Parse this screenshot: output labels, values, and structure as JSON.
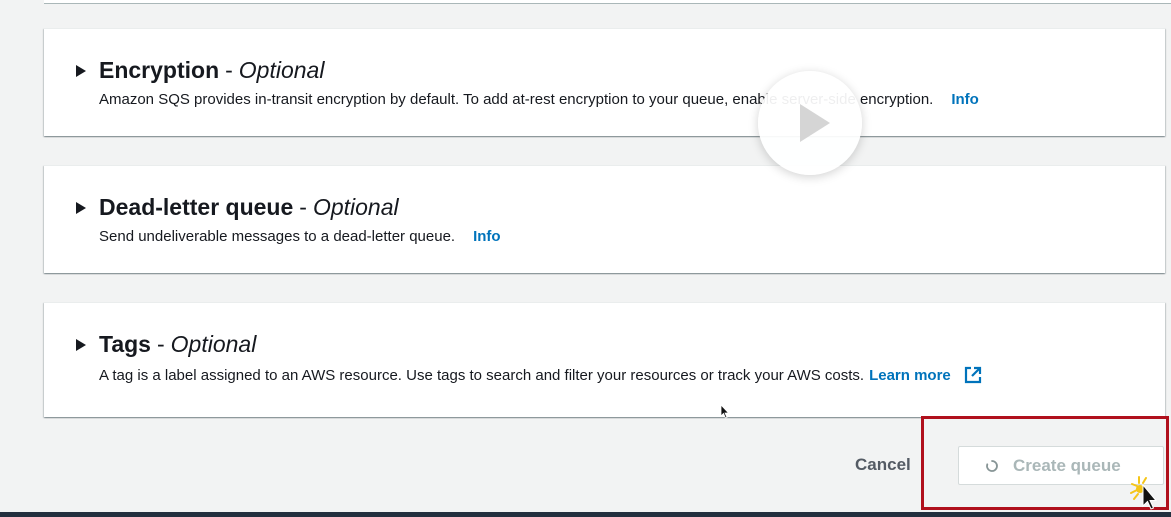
{
  "sections": [
    {
      "title": "Encryption",
      "separator": "-",
      "optional": "Optional",
      "description": "Amazon SQS provides in-transit encryption by default. To add at-rest encryption to your queue, enable server-side encryption.",
      "link": "Info"
    },
    {
      "title": "Dead-letter queue",
      "separator": "-",
      "optional": "Optional",
      "description": "Send undeliverable messages to a dead-letter queue.",
      "link": "Info"
    },
    {
      "title": "Tags",
      "separator": "-",
      "optional": "Optional",
      "description": "A tag is a label assigned to an AWS resource. Use tags to search and filter your resources or track your AWS costs.",
      "link": "Learn more"
    }
  ],
  "actions": {
    "cancel_label": "Cancel",
    "create_label": "Create queue"
  },
  "colors": {
    "link": "#0073bb",
    "highlight": "#b0101c",
    "disabled_text": "#aab7b8"
  },
  "icons": [
    "caret-right-icon",
    "external-link-icon",
    "spinner-icon",
    "play-icon",
    "cursor-icon"
  ]
}
